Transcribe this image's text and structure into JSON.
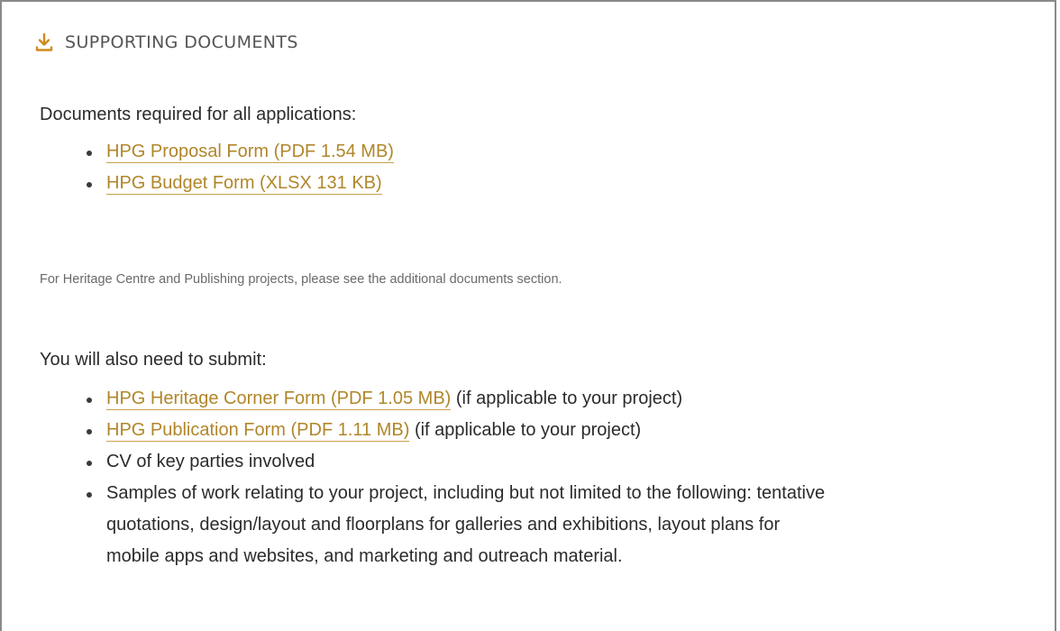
{
  "section": {
    "icon": "download-icon",
    "title": "SUPPORTING DOCUMENTS",
    "accent_color": "#d08a1e"
  },
  "required": {
    "intro": "Documents required for all applications:",
    "items": [
      {
        "link": "HPG Proposal Form (PDF 1.54 MB)"
      },
      {
        "link": "HPG Budget Form (XLSX 131 KB)"
      }
    ]
  },
  "note": "For Heritage Centre and Publishing projects, please see the additional documents section.",
  "also": {
    "intro": "You will also need to submit:",
    "items": [
      {
        "link": "HPG Heritage Corner Form (PDF 1.05 MB)",
        "suffix": " (if applicable to your project)"
      },
      {
        "link": "HPG Publication Form (PDF 1.11 MB)",
        "suffix": " (if applicable to your project)"
      },
      {
        "text": "CV of key parties involved"
      },
      {
        "text_lines": [
          "Samples of work relating to your project, including but not limited to the following: tentative",
          "quotations, design/layout and floorplans for galleries and exhibitions, layout plans for",
          "mobile apps and websites, and marketing and outreach material."
        ]
      }
    ]
  },
  "colors": {
    "link": "#b0862a",
    "link_underline": "#c9a24a",
    "text": "#2b2b2b",
    "muted": "#6a6a6a",
    "border": "#8a8a8a"
  }
}
